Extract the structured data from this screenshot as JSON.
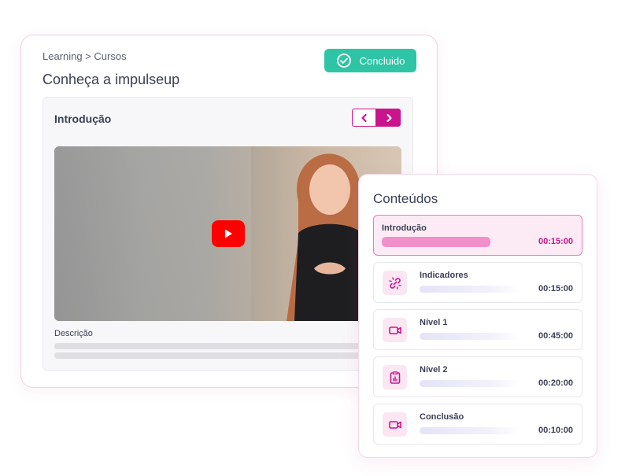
{
  "course": {
    "breadcrumb": "Learning > Cursos",
    "title": "Conheça a impulseup",
    "status_badge": "Concluido",
    "lesson_title": "Introdução",
    "description_label": "Descrição"
  },
  "contents": {
    "title": "Conteúdos",
    "items": [
      {
        "label": "Introdução",
        "time": "00:15:00"
      },
      {
        "label": "Indicadores",
        "time": "00:15:00",
        "icon": "link-broken-icon"
      },
      {
        "label": "Nível 1",
        "time": "00:45:00",
        "icon": "video-icon"
      },
      {
        "label": "Nível 2",
        "time": "00:20:00",
        "icon": "clipboard-chart-icon"
      },
      {
        "label": "Conclusão",
        "time": "00:10:00",
        "icon": "video-icon"
      }
    ]
  },
  "colors": {
    "accent": "#c9148c",
    "success": "#2ec4a6",
    "play": "#ff0000"
  }
}
